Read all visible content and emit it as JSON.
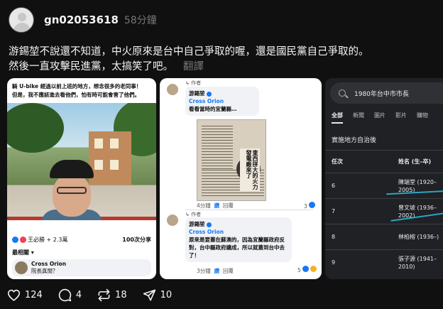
{
  "post": {
    "username": "gn02053618",
    "time": "58分鐘",
    "text_line1": "游錫堃不說還不知道，中火原來是台中自己爭取的喔，還是國民黨自己爭取的。",
    "text_line2": "然後一直攻擊民進黨，太搞笑了吧。",
    "translate_label": "翻譯"
  },
  "card1": {
    "caption_line1": "騎 U-bike 經過以前上班的地方，想念很多的老同事！",
    "caption_line2": "但是，我不應該進去看他們，怕有時可能會害了他們。",
    "reactions": "王必勝 + 2.3萬",
    "shares": "100次分享",
    "related": "最相關 ▾",
    "commenter_name": "Cross Orion",
    "commenter_text": "院長真閒？"
  },
  "card2": {
    "author": "游錫堃",
    "reply_tag": "↳ 作者",
    "c1_name": "Cross Orion",
    "c1_text": "看看當時的宜蘭縣…",
    "c1_meta_time": "4分鐘",
    "c1_meta_like": "讚",
    "c1_meta_reply": "回覆",
    "c1_count": "3",
    "headline": "東西拼大的火力發電廠來了",
    "reply_tag2": "↳ 作者",
    "author2": "游錫堃",
    "c2_name": "Cross Orion",
    "c2_text": "原來是要蓋在蘇澳的，因為宜蘭縣政府反對，台中縣政府讓成，所以就蓋到台中去了！",
    "c2_meta_time": "3分鐘",
    "c2_meta_like": "讚",
    "c2_meta_reply": "回覆",
    "c2_count": "5"
  },
  "card3": {
    "search_query": "1980年台中市市長",
    "tabs": [
      "全部",
      "新聞",
      "圖片",
      "影片",
      "購物"
    ],
    "heading": "實施地方自治後",
    "col_term": "任次",
    "col_name": "姓名 (生–卒)",
    "rows": [
      {
        "term": "6",
        "name1": "陳端堂 (1920–",
        "name2": "2005)"
      },
      {
        "term": "7",
        "name1": "曾文坡 (1936–",
        "name2": "2002)"
      },
      {
        "term": "8",
        "name1": "林柏榕 (1936–)",
        "name2": ""
      },
      {
        "term": "9",
        "name1": "張子源 (1941–",
        "name2": "2010)"
      }
    ]
  },
  "actions": {
    "likes": "124",
    "comments": "4",
    "reposts": "18",
    "shares": "10"
  },
  "colors": {
    "background": "#101010",
    "text": "#f3f5f7",
    "muted": "#777777",
    "facebook_blue": "#1877f2",
    "highlight": "#2aa6c4"
  }
}
